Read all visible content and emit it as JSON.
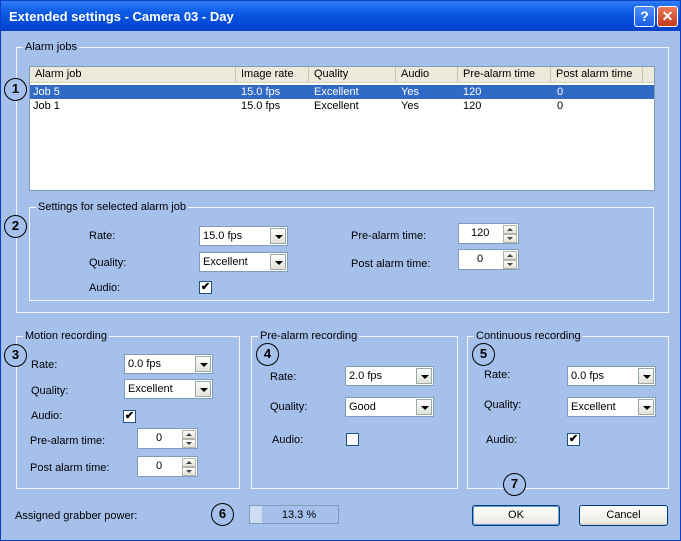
{
  "window": {
    "title": "Extended settings - Camera 03 - Day",
    "help_label": "?",
    "close_label": "✕"
  },
  "alarm_jobs": {
    "group_label": "Alarm jobs",
    "columns": [
      "Alarm job",
      "Image rate",
      "Quality",
      "Audio",
      "Pre-alarm time",
      "Post alarm time"
    ],
    "rows": [
      {
        "job": "Job  5",
        "rate": "15.0 fps",
        "quality": "Excellent",
        "audio": "Yes",
        "pre": "120",
        "post": "0",
        "selected": true
      },
      {
        "job": "Job 1",
        "rate": "15.0 fps",
        "quality": "Excellent",
        "audio": "Yes",
        "pre": "120",
        "post": "0",
        "selected": false
      }
    ]
  },
  "selected_job": {
    "group_label": "Settings for selected alarm job",
    "rate_label": "Rate:",
    "rate_value": "15.0 fps",
    "quality_label": "Quality:",
    "quality_value": "Excellent",
    "audio_label": "Audio:",
    "audio_checked": true,
    "pre_alarm_label": "Pre-alarm time:",
    "pre_alarm_value": "120",
    "post_alarm_label": "Post alarm time:",
    "post_alarm_value": "0"
  },
  "motion": {
    "group_label": "Motion recording",
    "rate_label": "Rate:",
    "rate_value": "0.0 fps",
    "quality_label": "Quality:",
    "quality_value": "Excellent",
    "audio_label": "Audio:",
    "audio_checked": true,
    "pre_alarm_label": "Pre-alarm time:",
    "pre_alarm_value": "0",
    "post_alarm_label": "Post alarm time:",
    "post_alarm_value": "0"
  },
  "prealarm": {
    "group_label": "Pre-alarm recording",
    "rate_label": "Rate:",
    "rate_value": "2.0 fps",
    "quality_label": "Quality:",
    "quality_value": "Good",
    "audio_label": "Audio:",
    "audio_checked": false
  },
  "continuous": {
    "group_label": "Continuous recording",
    "rate_label": "Rate:",
    "rate_value": "0.0 fps",
    "quality_label": "Quality:",
    "quality_value": "Excellent",
    "audio_label": "Audio:",
    "audio_checked": true
  },
  "grabber": {
    "label": "Assigned grabber power:",
    "value_text": "13.3 %",
    "fraction": 0.133
  },
  "buttons": {
    "ok": "OK",
    "cancel": "Cancel"
  },
  "callouts": [
    "1",
    "2",
    "3",
    "4",
    "5",
    "6",
    "7"
  ]
}
